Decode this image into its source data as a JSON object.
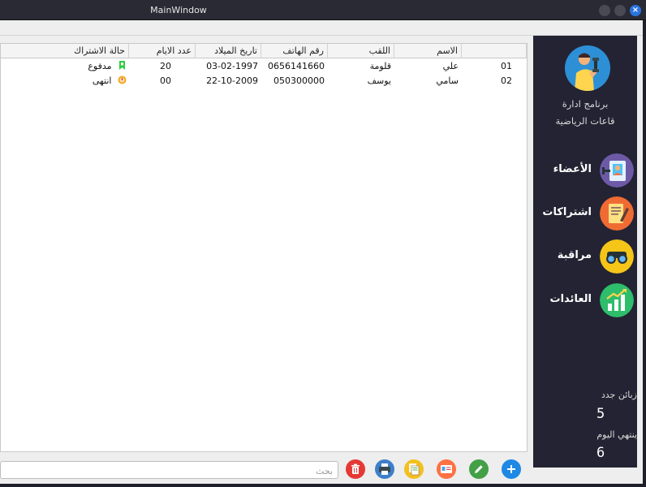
{
  "window": {
    "title": "MainWindow"
  },
  "table": {
    "columns": [
      "الاسم",
      "اللقب",
      "رقم الهاتف",
      "تاريخ الميلاد",
      "عدد الايام",
      "حالة الاشتراك"
    ],
    "rows": [
      {
        "id": "01",
        "name": "علي",
        "lastname": "قلومة",
        "phone": "0656141660",
        "birth": "03-02-1997",
        "days": "20",
        "status": "مدفوع",
        "status_icon": "green-bookmark-icon"
      },
      {
        "id": "02",
        "name": "سامي",
        "lastname": "يوسف",
        "phone": "050300000",
        "birth": "22-10-2009",
        "days": "00",
        "status": "انتهى",
        "status_icon": "orange-alert-icon"
      }
    ]
  },
  "search": {
    "placeholder": "بحث"
  },
  "toolbar": {
    "buttons": [
      {
        "name": "delete",
        "color": "#e53935",
        "icon": "trash-icon"
      },
      {
        "name": "print",
        "color": "#3f7fc9",
        "icon": "printer-icon"
      },
      {
        "name": "cards",
        "color": "#f2c01e",
        "icon": "cards-icon"
      },
      {
        "name": "card-view",
        "color": "#ff7043",
        "icon": "id-card-icon"
      },
      {
        "name": "edit",
        "color": "#43a047",
        "icon": "pencil-icon"
      },
      {
        "name": "add",
        "color": "#1e88e5",
        "icon": "plus-icon"
      }
    ]
  },
  "sidebar": {
    "app_name_line1": "برنامج ادارة",
    "app_name_line2": "قاعات الرياضية",
    "nav": [
      {
        "label": "الأعضاء",
        "icon": "members-icon",
        "color": "#6d5aa7"
      },
      {
        "label": "اشتراكات",
        "icon": "subscriptions-icon",
        "color": "#f06b34"
      },
      {
        "label": "مراقبة",
        "icon": "binoculars-icon",
        "color": "#f5c518"
      },
      {
        "label": "العائدات",
        "icon": "revenue-chart-icon",
        "color": "#2ebd6b"
      }
    ],
    "stats": {
      "new_clients_label": "زبائن جدد",
      "new_clients_value": "5",
      "ending_today_label": "ينتهي اليوم",
      "ending_today_value": "6"
    }
  }
}
